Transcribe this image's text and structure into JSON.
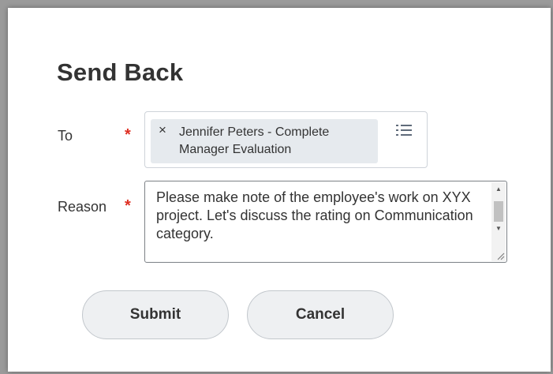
{
  "dialog": {
    "title": "Send Back"
  },
  "form": {
    "to": {
      "label": "To",
      "required_marker": "*",
      "selected_item": "Jennifer Peters - Complete Manager Evaluation",
      "remove_glyph": "×",
      "prompt_icon": "list-icon"
    },
    "reason": {
      "label": "Reason",
      "required_marker": "*",
      "value": "Please make note of the employee's work on XYX project. Let's discuss the rating on Communication category."
    }
  },
  "actions": {
    "submit_label": "Submit",
    "cancel_label": "Cancel"
  },
  "colors": {
    "required": "#de2e21",
    "text": "#333333",
    "button_bg": "#eef0f2",
    "pill_bg": "#e6eaee"
  }
}
